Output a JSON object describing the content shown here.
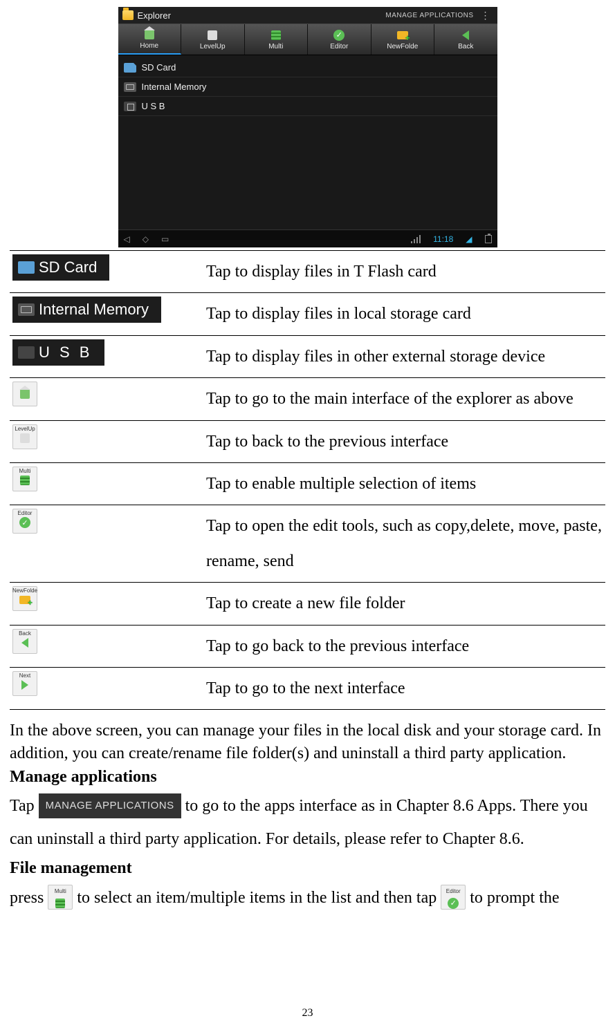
{
  "screenshot": {
    "title": "Explorer",
    "manage_label": "MANAGE APPLICATIONS",
    "tabs": [
      "Home",
      "LevelUp",
      "Multi",
      "Editor",
      "NewFolde",
      "Back"
    ],
    "items": [
      "SD Card",
      "Internal Memory",
      "U S B"
    ],
    "clock": "11:18"
  },
  "legend": [
    {
      "icon": "sd-card",
      "label": "SD Card",
      "desc": "Tap to display files in T Flash card"
    },
    {
      "icon": "internal-memory",
      "label": "Internal Memory",
      "desc": "Tap to display files in local storage card"
    },
    {
      "icon": "usb",
      "label": "U S B",
      "desc": "Tap to display files in other external storage device"
    },
    {
      "icon": "home",
      "label": "",
      "desc": "Tap to go to the main interface of the explorer as above"
    },
    {
      "icon": "levelup",
      "label": "LevelUp",
      "desc": "Tap to back to the previous interface"
    },
    {
      "icon": "multi",
      "label": "Multi",
      "desc": "Tap to enable multiple selection of items"
    },
    {
      "icon": "editor",
      "label": "Editor",
      "desc": "Tap to open the edit tools, such as copy,delete, move, paste, rename, send"
    },
    {
      "icon": "newfolder",
      "label": "NewFolde",
      "desc": "Tap to create a new file folder"
    },
    {
      "icon": "back",
      "label": "Back",
      "desc": "Tap to go back to the previous interface"
    },
    {
      "icon": "next",
      "label": "Next",
      "desc": "Tap to go to the next interface"
    }
  ],
  "body": {
    "p1": "In the above screen, you can manage your files in the local disk and your storage card. In addition, you can create/rename file folder(s) and uninstall a third party application.",
    "h1": "Manage applications",
    "tap_word": "Tap ",
    "manage_btn": "MANAGE APPLICATIONS",
    "p2_after": " to go to the apps interface as in Chapter 8.6 Apps. There you can uninstall a third party application. For details, please refer to Chapter 8.6.",
    "h2": "File management",
    "press_word": "press ",
    "multi_label": "Multi",
    "p3_mid": " to select an item/multiple items in the list and then tap ",
    "editor_label": "Editor",
    "p3_end": " to prompt the"
  },
  "page_number": "23"
}
